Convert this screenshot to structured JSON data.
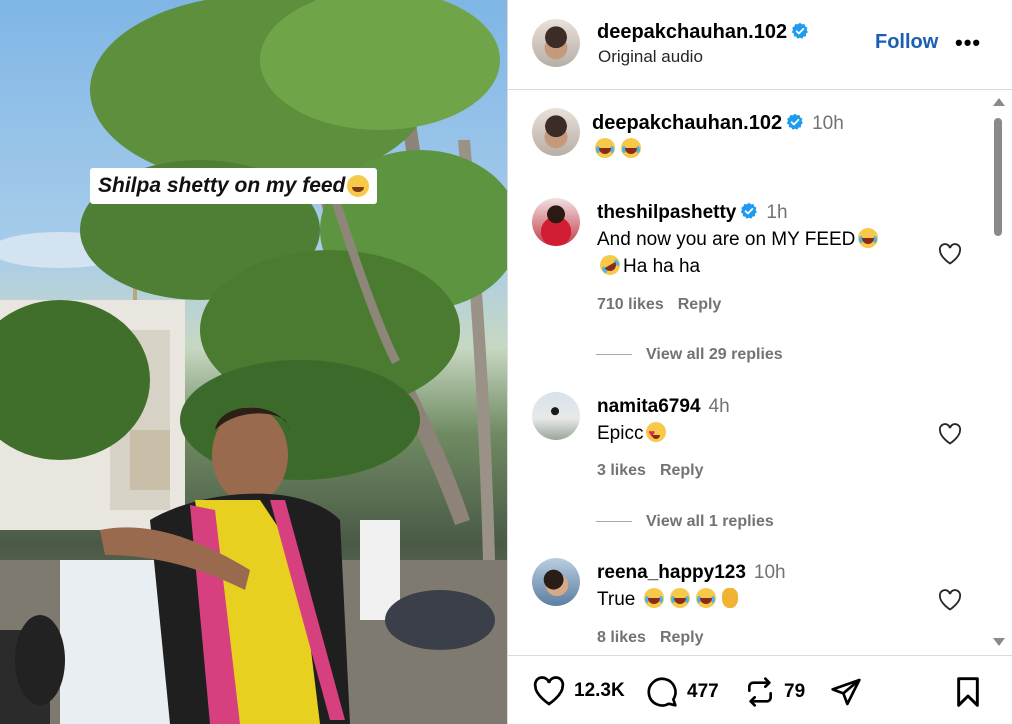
{
  "media": {
    "caption": "Shilpa shetty on my feed",
    "caption_emoji": "grinning-sweat-emoji"
  },
  "header": {
    "username": "deepakchauhan.102",
    "subtitle": "Original audio",
    "follow_label": "Follow",
    "more_label": "•••"
  },
  "caption_comment": {
    "username": "deepakchauhan.102",
    "time": "10h"
  },
  "comments": [
    {
      "username": "theshilpashetty",
      "verified": true,
      "time": "1h",
      "line1": "And now you are on MY FEED",
      "line2": "Ha ha ha",
      "likes": "710 likes",
      "reply": "Reply",
      "view_replies": "View all 29 replies"
    },
    {
      "username": "namita6794",
      "verified": false,
      "time": "4h",
      "line1": "Epicc",
      "likes": "3 likes",
      "reply": "Reply",
      "view_replies": "View all 1 replies"
    },
    {
      "username": "reena_happy123",
      "verified": false,
      "time": "10h",
      "line1": "True",
      "likes": "8 likes",
      "reply": "Reply"
    }
  ],
  "actions": {
    "likes": "12.3K",
    "comments": "477",
    "reposts": "79"
  },
  "colors": {
    "follow": "#1a5fb4",
    "verified": "#1d9bf0",
    "muted_text": "#737373"
  }
}
